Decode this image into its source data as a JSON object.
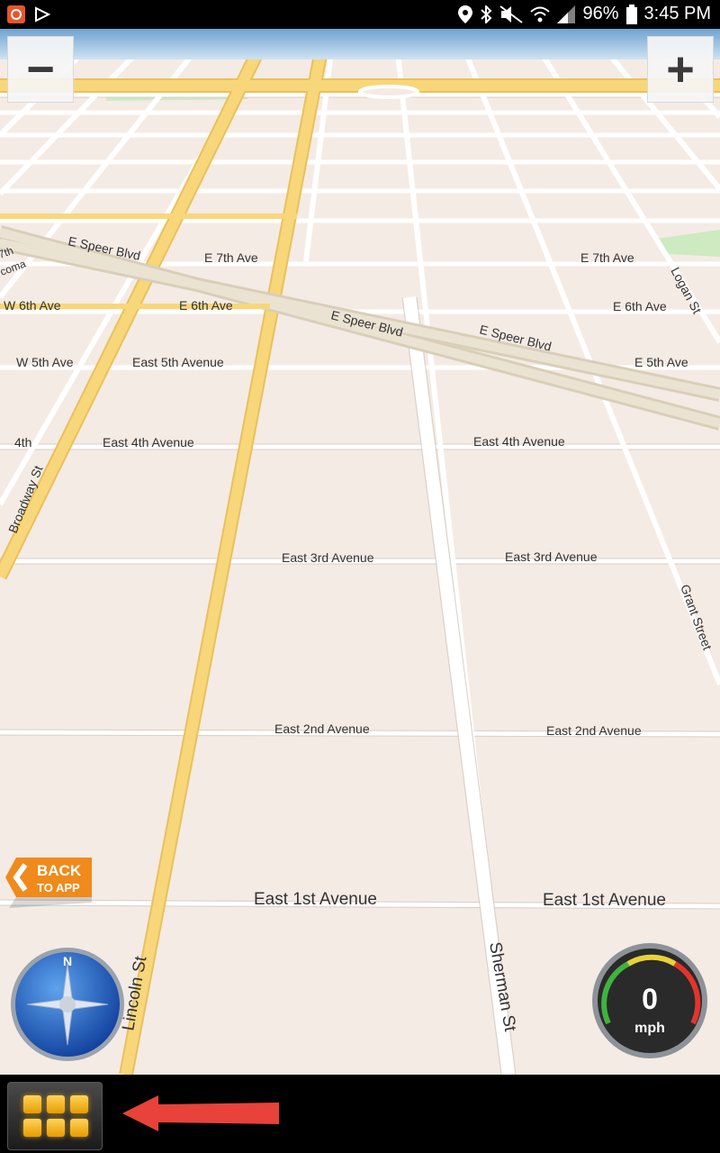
{
  "status_bar": {
    "battery": "96%",
    "time": "3:45 PM",
    "icons": [
      "app-notification-icon",
      "play-store-icon",
      "location-icon",
      "bluetooth-icon",
      "mute-icon",
      "wifi-icon",
      "signal-icon",
      "battery-icon"
    ]
  },
  "zoom": {
    "out_label": "−",
    "in_label": "+"
  },
  "map": {
    "streets": {
      "e_speer_blvd_1": "E Speer Blvd",
      "e_7th_ave_1": "E 7th Ave",
      "e_7th_ave_2": "E 7th Ave",
      "logan_st": "Logan St",
      "w_6th_ave": "W 6th Ave",
      "e_6th_ave_1": "E 6th Ave",
      "e_speer_blvd_2": "E Speer Blvd",
      "e_speer_blvd_3": "E Speer Blvd",
      "e_6th_ave_2": "E 6th Ave",
      "w_5th_ave": "W 5th Ave",
      "east_5th_avenue": "East 5th Avenue",
      "e_5th_ave": "E 5th Ave",
      "fourth": "4th",
      "east_4th_avenue_1": "East 4th Avenue",
      "east_4th_avenue_2": "East 4th Avenue",
      "broadway_st": "Broadway St",
      "east_3rd_avenue_1": "East 3rd Avenue",
      "east_3rd_avenue_2": "East 3rd Avenue",
      "grant_street": "Grant Street",
      "east_2nd_avenue_1": "East 2nd Avenue",
      "east_2nd_avenue_2": "East 2nd Avenue",
      "east_1st_avenue_1": "East 1st Avenue",
      "east_1st_avenue_2": "East 1st Avenue",
      "lincoln_st": "Lincoln St",
      "sherman_st": "Sherman St",
      "seventh_partial": "7th",
      "tacoma_partial": "coma"
    }
  },
  "back_to_app": {
    "line1": "BACK",
    "line2": "TO APP"
  },
  "compass": {
    "heading_letter": "N"
  },
  "speedometer": {
    "speed": "0",
    "unit": "mph"
  },
  "colors": {
    "map_bg": "#f4ebe5",
    "major_road": "#f8d67a",
    "minor_road": "#ffffff",
    "park": "#cdeac0",
    "accent_orange": "#f08a1c",
    "arrow_red": "#e8423a"
  }
}
